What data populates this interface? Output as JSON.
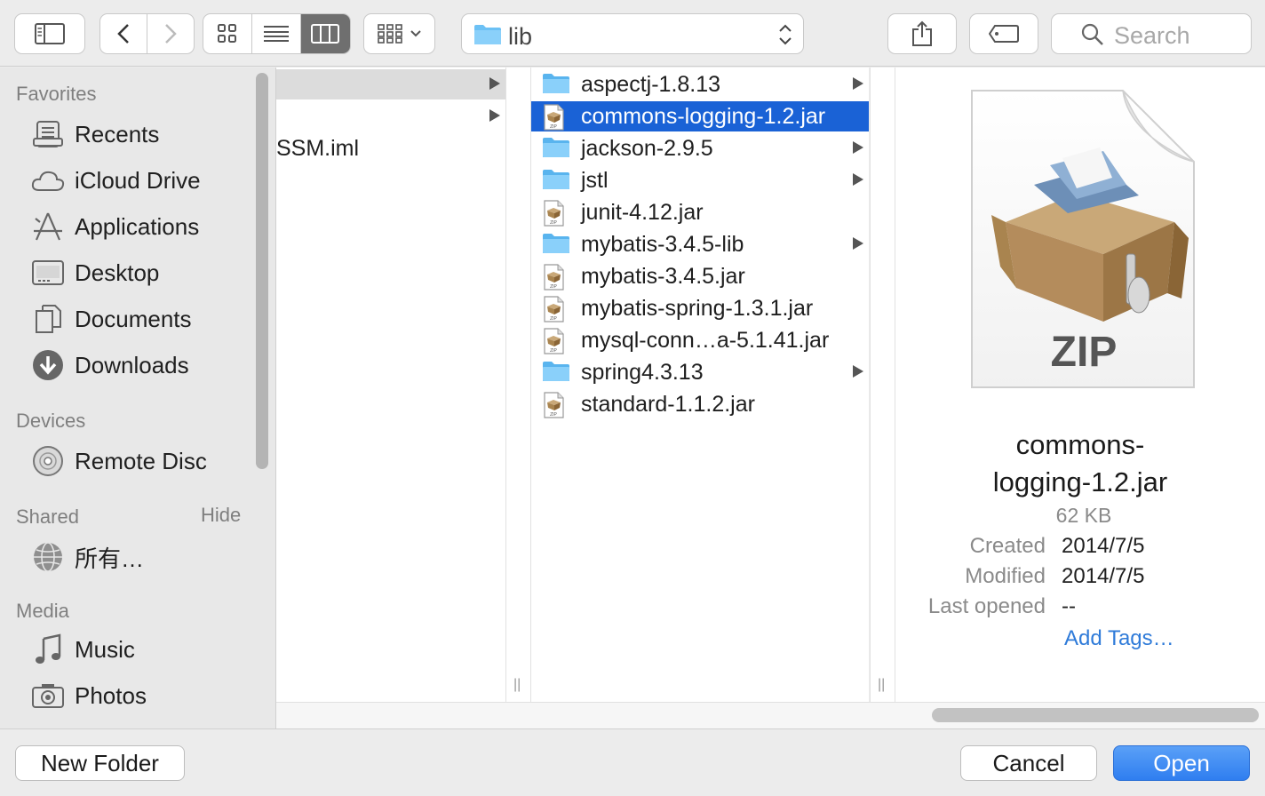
{
  "toolbar": {
    "path_label": "lib",
    "search_placeholder": "Search"
  },
  "sidebar": {
    "favorites_title": "Favorites",
    "favorites": [
      {
        "label": "Recents",
        "icon": "recents-icon"
      },
      {
        "label": "iCloud Drive",
        "icon": "cloud-icon"
      },
      {
        "label": "Applications",
        "icon": "applications-icon"
      },
      {
        "label": "Desktop",
        "icon": "desktop-icon"
      },
      {
        "label": "Documents",
        "icon": "documents-icon"
      },
      {
        "label": "Downloads",
        "icon": "downloads-icon"
      }
    ],
    "devices_title": "Devices",
    "devices": [
      {
        "label": "Remote Disc",
        "icon": "disc-icon"
      }
    ],
    "shared_title": "Shared",
    "shared_hide": "Hide",
    "shared": [
      {
        "label": "所有…",
        "icon": "network-globe-icon"
      }
    ],
    "media_title": "Media",
    "media": [
      {
        "label": "Music",
        "icon": "music-note-icon"
      },
      {
        "label": "Photos",
        "icon": "camera-icon"
      }
    ]
  },
  "column1": {
    "items": [
      "",
      "",
      "SSM.iml"
    ]
  },
  "column2": {
    "items": [
      {
        "name": "aspectj-1.8.13",
        "kind": "folder"
      },
      {
        "name": "commons-logging-1.2.jar",
        "kind": "jar",
        "selected": true
      },
      {
        "name": "jackson-2.9.5",
        "kind": "folder"
      },
      {
        "name": "jstl",
        "kind": "folder"
      },
      {
        "name": "junit-4.12.jar",
        "kind": "jar"
      },
      {
        "name": "mybatis-3.4.5-lib",
        "kind": "folder"
      },
      {
        "name": "mybatis-3.4.5.jar",
        "kind": "jar"
      },
      {
        "name": "mybatis-spring-1.3.1.jar",
        "kind": "jar"
      },
      {
        "name": "mysql-conn…a-5.1.41.jar",
        "kind": "jar"
      },
      {
        "name": "spring4.3.13",
        "kind": "folder"
      },
      {
        "name": "standard-1.1.2.jar",
        "kind": "jar"
      }
    ]
  },
  "preview": {
    "badge": "ZIP",
    "name_line1": "commons-",
    "name_line2": "logging-1.2.jar",
    "size": "62 KB",
    "created_label": "Created",
    "created_value": "2014/7/5",
    "modified_label": "Modified",
    "modified_value": "2014/7/5",
    "opened_label": "Last opened",
    "opened_value": "--",
    "add_tags": "Add Tags…"
  },
  "buttons": {
    "new_folder": "New Folder",
    "cancel": "Cancel",
    "open": "Open"
  },
  "colors": {
    "selection": "#1a62d6",
    "accent_blue": "#2f7ef0",
    "folder_blue": "#6cc1f5"
  }
}
